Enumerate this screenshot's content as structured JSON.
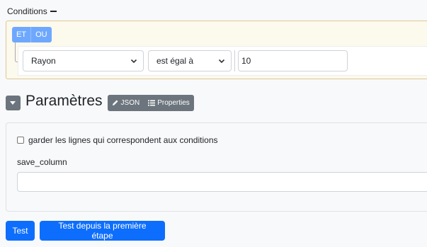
{
  "conditions": {
    "title": "Conditions",
    "and_label": "ET",
    "or_label": "OU",
    "rule": {
      "field": "Rayon",
      "operator": "est égal à",
      "value": "10"
    }
  },
  "params": {
    "title": "Paramètres",
    "json_label": "JSON",
    "properties_label": "Properties",
    "checkbox_label": "garder les lignes qui correspondent aux conditions",
    "checkbox_checked": false,
    "save_column_label": "save_column",
    "save_column_value": ""
  },
  "actions": {
    "test_label": "Test",
    "test_from_start_label": "Test depuis la première étape"
  },
  "colors": {
    "primary": "#0d6efd",
    "group_bg": "#fcf9ed",
    "secondary": "#6c757d"
  }
}
